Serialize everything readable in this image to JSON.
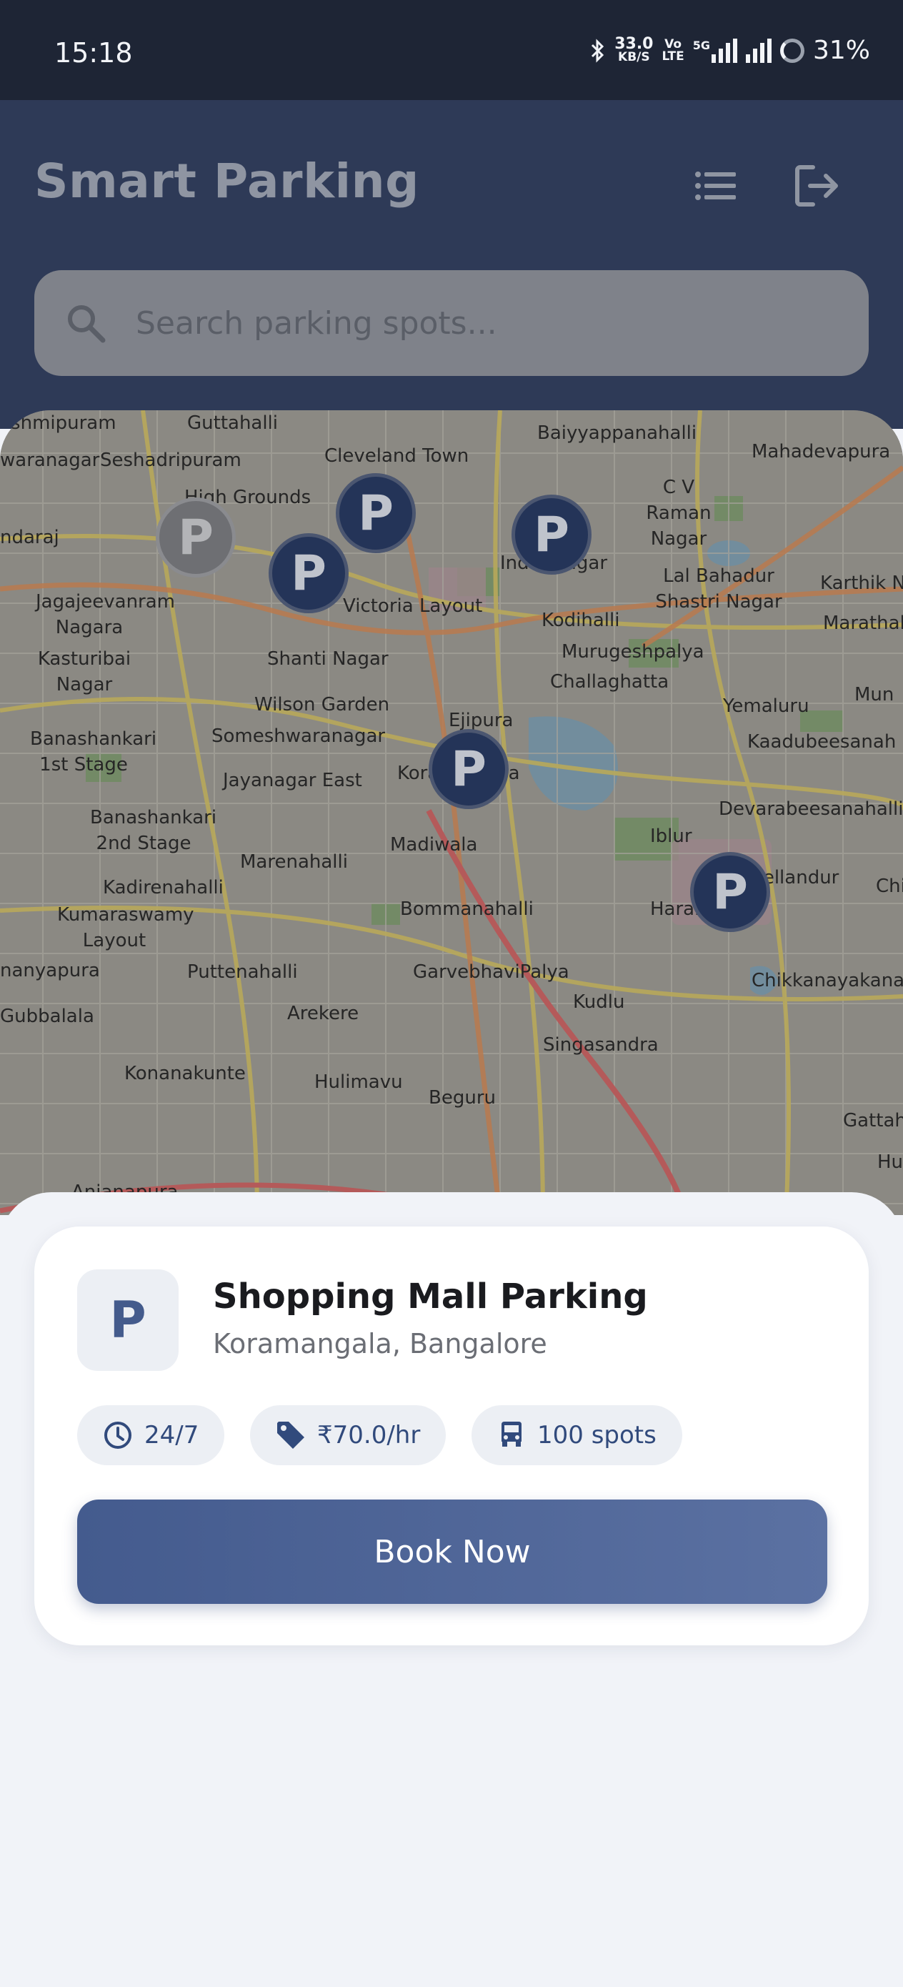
{
  "status_bar": {
    "time": "15:18",
    "net_speed_value": "33.0",
    "net_speed_unit": "KB/S",
    "volte_top": "Vo",
    "volte_bottom": "LTE",
    "network": "5G",
    "battery": "31%"
  },
  "header": {
    "title": "Smart Parking",
    "list_icon": "list-icon",
    "logout_icon": "logout-icon"
  },
  "search": {
    "placeholder": "Search parking spots...",
    "value": ""
  },
  "map": {
    "places": [
      "kshmipuram",
      "Guttahalli",
      "Baiyyappanahalli",
      "Mahadevapura",
      "waranagar",
      "Seshadripuram",
      "Cleveland Town",
      "C V Raman Nagar",
      "High Grounds",
      "ndaraj",
      "Indiranagar",
      "Lal Bahadur Shastri Nagar",
      "Karthik Nag",
      "Jagajeevanram Nagara",
      "Victoria Layout",
      "Kodihalli",
      "Murugeshpalya",
      "Marathahal",
      "Kasturibai Nagar",
      "Shanti Nagar",
      "Wilson Garden",
      "Challaghatta",
      "Yemaluru",
      "Mun",
      "Banashankari 1st Stage",
      "Someshwaranagar",
      "Ejipura",
      "Koramangala",
      "Kaadubeesanah",
      "Jayanagar East",
      "Devarabeesanahalli",
      "Banashankari 2nd Stage",
      "Madiwala",
      "Iblur",
      "Marenahalli",
      "Kadirenahalli",
      "Kumaraswamy Layout",
      "Bellandur",
      "Haralur",
      "Chi",
      "Bommanahalli",
      "nanyapura",
      "Puttenahalli",
      "GarvebhaviPalya",
      "Chikkanayakanahal",
      "Kudlu",
      "Gubbalala",
      "Arekere",
      "Singasandra",
      "Konanakunte",
      "Hulimavu",
      "Beguru",
      "Gattaha",
      "Hu",
      "Anjanapura"
    ],
    "markers": [
      {
        "label": "P",
        "state": "inactive"
      },
      {
        "label": "P",
        "state": "active"
      },
      {
        "label": "P",
        "state": "active"
      },
      {
        "label": "P",
        "state": "active"
      },
      {
        "label": "P",
        "state": "active"
      },
      {
        "label": "P",
        "state": "active"
      }
    ]
  },
  "parking_card": {
    "icon_letter": "P",
    "name": "Shopping Mall Parking",
    "location": "Koramangala, Bangalore",
    "hours": "24/7",
    "rate": "₹70.0/hr",
    "spots": "100 spots",
    "hours_icon": "clock-icon",
    "rate_icon": "price-tag-icon",
    "spots_icon": "car-icon",
    "book_label": "Book Now"
  },
  "colors": {
    "header_bg": "#2e3a57",
    "accent": "#445b8e",
    "marker": "#243458"
  }
}
